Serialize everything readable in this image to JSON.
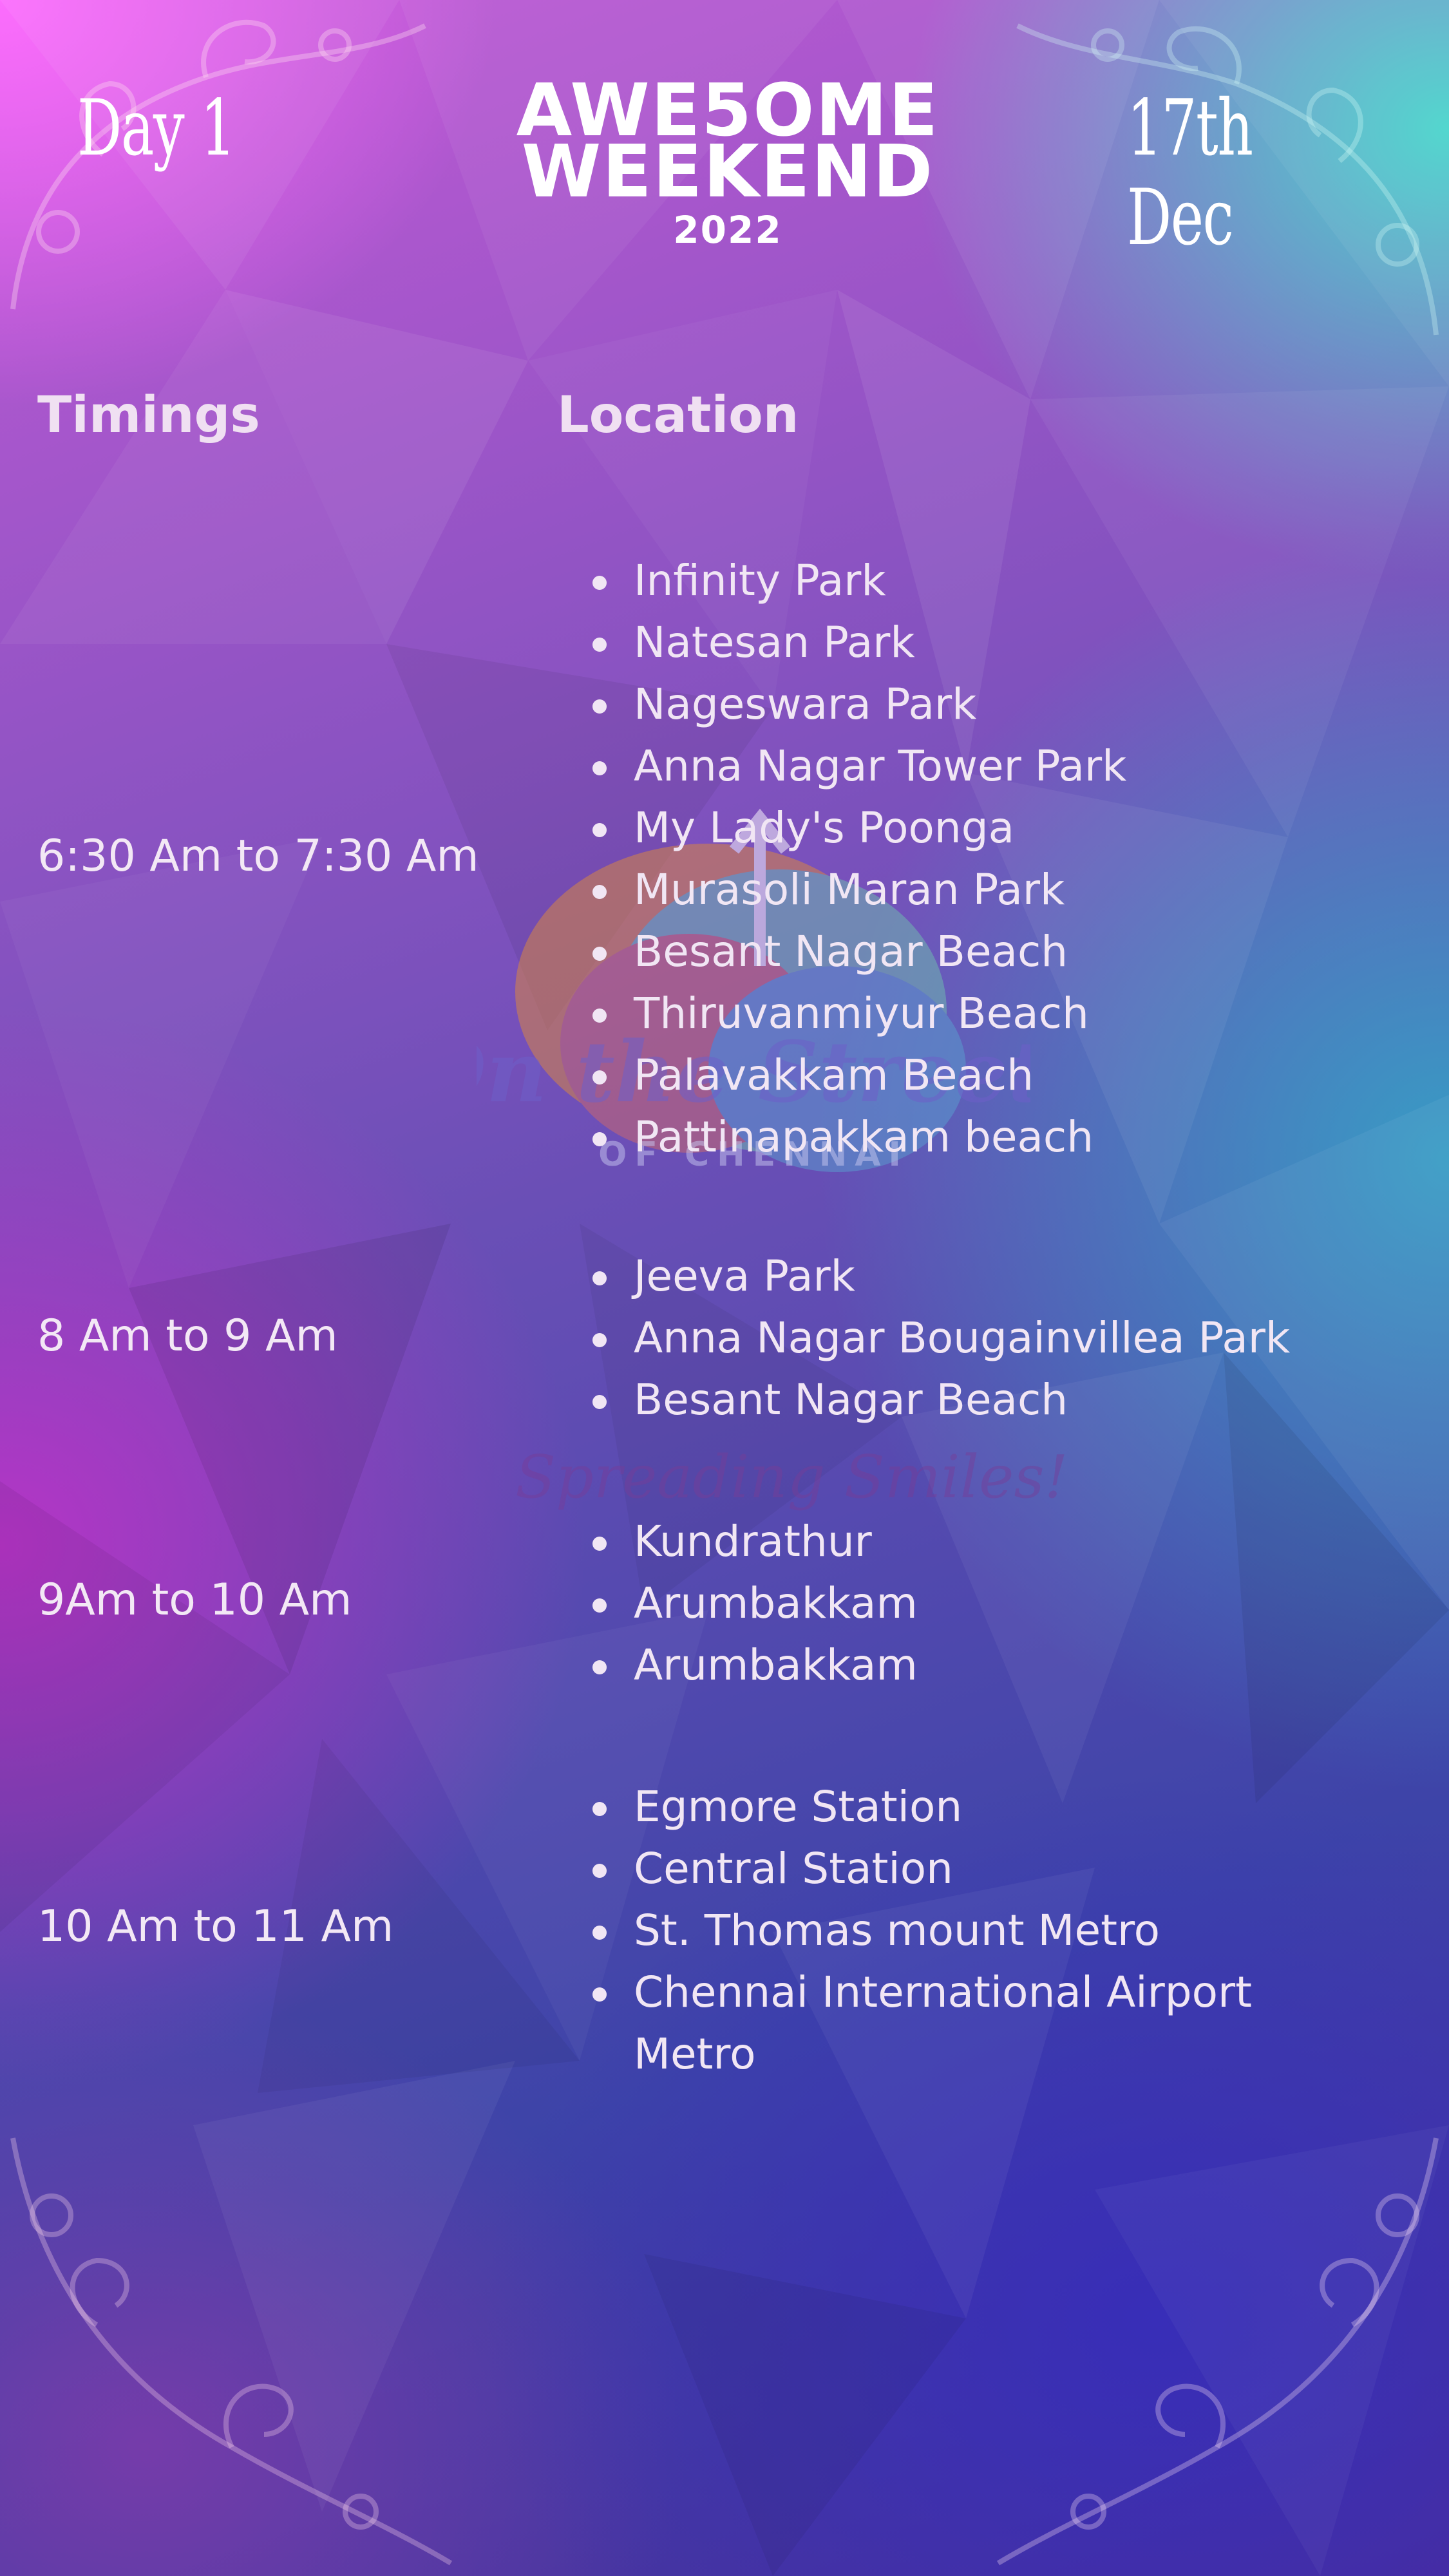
{
  "header": {
    "day": "Day 1",
    "title_line1": "AWE5OME",
    "title_line2": "WEEKEND",
    "year": "2022",
    "date": "17th Dec"
  },
  "columns": {
    "timings": "Timings",
    "location": "Location"
  },
  "schedule": [
    {
      "time": "6:30 Am to 7:30 Am",
      "locations": [
        "Infinity Park",
        "Natesan Park",
        "Nageswara Park",
        "Anna Nagar Tower Park",
        "My Lady's Poonga",
        "Murasoli Maran Park",
        "Besant Nagar Beach",
        "Thiruvanmiyur Beach",
        "Palavakkam Beach",
        "Pattinapakkam beach"
      ]
    },
    {
      "time": "8 Am to 9 Am",
      "locations": [
        "Jeeva Park",
        "Anna Nagar  Bougainvillea Park",
        "Besant Nagar Beach"
      ]
    },
    {
      "time": "9Am to 10 Am",
      "locations": [
        "Kundrathur",
        "Arumbakkam",
        "Arumbakkam"
      ]
    },
    {
      "time": "10 Am to 11 Am",
      "locations": [
        "Egmore Station",
        "Central Station",
        "St. Thomas mount Metro",
        "Chennai International Airport Metro"
      ]
    }
  ],
  "watermark": {
    "logo_line1": "On the Streets",
    "logo_line2": "OF CHENNAI",
    "tagline": "Spreading Smiles!"
  },
  "colors": {
    "top_left": "#f56ef7",
    "top_right": "#45d3c8",
    "bottom": "#3b2f9e",
    "text": "#f2e6f4"
  }
}
